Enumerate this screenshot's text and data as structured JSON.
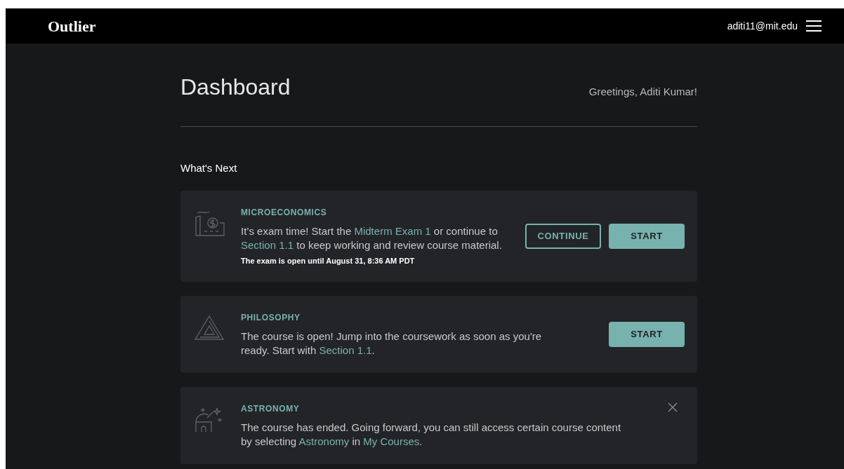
{
  "header": {
    "logo": "Outlier",
    "email": "aditi11@mit.edu"
  },
  "page": {
    "title": "Dashboard",
    "greeting": "Greetings, Aditi Kumar!"
  },
  "section_title": "What's Next",
  "cards": [
    {
      "kind": "factory",
      "course": "MICROECONOMICS",
      "body": [
        {
          "kind": "text",
          "text": "It’s exam time! Start the "
        },
        {
          "kind": "link",
          "text": "Midterm Exam 1"
        },
        {
          "kind": "text",
          "text": " or continue to "
        },
        {
          "kind": "link",
          "text": "Section 1.1"
        },
        {
          "kind": "text",
          "text": " to keep working and review course material."
        }
      ],
      "note": "The exam is open until August 31, 8:36 AM PDT",
      "buttons": [
        {
          "kind": "outline",
          "label": "CONTINUE"
        },
        {
          "kind": "filled",
          "label": "START"
        }
      ],
      "closable": false
    },
    {
      "kind": "triangle",
      "course": "PHILOSOPHY",
      "body": [
        {
          "kind": "text",
          "text": "The course is open! Jump into the coursework as soon as you're ready. Start with "
        },
        {
          "kind": "link",
          "text": "Section 1.1"
        },
        {
          "kind": "text",
          "text": "."
        }
      ],
      "buttons": [
        {
          "kind": "filled",
          "label": "START"
        }
      ],
      "closable": false
    },
    {
      "kind": "observatory",
      "course": "ASTRONOMY",
      "body": [
        {
          "kind": "text",
          "text": "The course has ended. Going forward, you can still access certain course content by selecting "
        },
        {
          "kind": "link",
          "text": "Astronomy"
        },
        {
          "kind": "text",
          "text": " in "
        },
        {
          "kind": "link",
          "text": "My Courses"
        },
        {
          "kind": "text",
          "text": "."
        }
      ],
      "closable": true
    }
  ]
}
